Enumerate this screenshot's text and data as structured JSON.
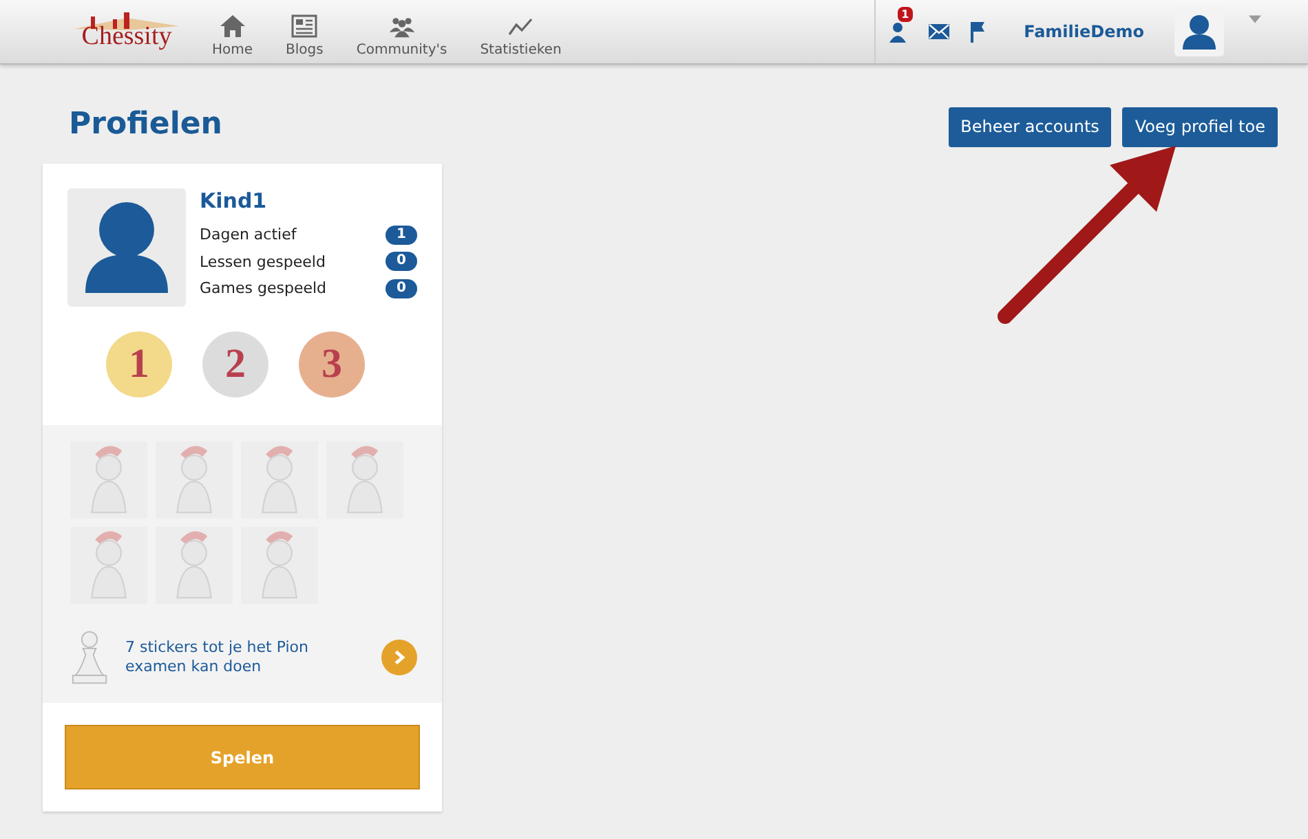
{
  "nav": {
    "logo": "Chessity",
    "items": [
      {
        "label": "Home",
        "kind": "home"
      },
      {
        "label": "Blogs",
        "kind": "blog"
      },
      {
        "label": "Community's",
        "kind": "community"
      },
      {
        "label": "Statistieken",
        "kind": "stats"
      }
    ],
    "notification_count": "1",
    "username": "FamilieDemo"
  },
  "page": {
    "title": "Profielen",
    "buttons": [
      "Beheer accounts",
      "Voeg profiel toe"
    ]
  },
  "profile": {
    "name": "Kind1",
    "stats": [
      {
        "label": "Dagen actief",
        "value": "1"
      },
      {
        "label": "Lessen gespeeld",
        "value": "0"
      },
      {
        "label": "Games gespeeld",
        "value": "0"
      }
    ],
    "medals": [
      {
        "label": "1",
        "color": "#f3d98a"
      },
      {
        "label": "2",
        "color": "#dcdcdc"
      },
      {
        "label": "3",
        "color": "#e6b08f"
      }
    ],
    "progress_text": "7 stickers tot je het Pion examen kan doen",
    "play_button": "Spelen"
  }
}
